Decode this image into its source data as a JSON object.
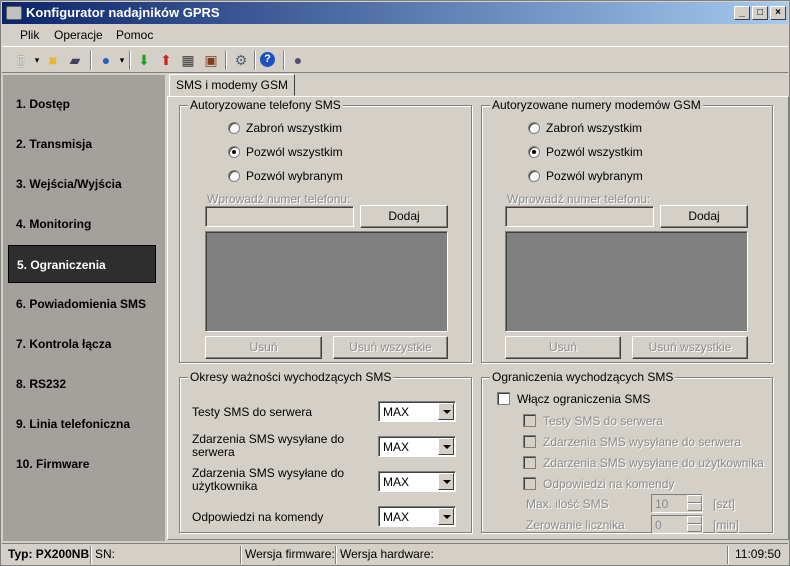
{
  "window": {
    "title": "Konfigurator nadajników GPRS",
    "minimize": "_",
    "maximize": "□",
    "close": "×"
  },
  "menu": [
    "Plik",
    "Operacje",
    "Pomoc"
  ],
  "toolbar": {
    "icons": [
      "new-icon",
      "open-folder-icon",
      "save-icon",
      "connect-globe-icon",
      "download-icon",
      "upload-icon",
      "calendar-icon",
      "computer-icon",
      "settings-icon",
      "help-icon",
      "exit-icon"
    ]
  },
  "sidebar": {
    "items": [
      {
        "label": "1. Dostęp"
      },
      {
        "label": "2. Transmisja"
      },
      {
        "label": "3. Wejścia/Wyjścia"
      },
      {
        "label": "4. Monitoring"
      },
      {
        "label": "5. Ograniczenia",
        "active": true
      },
      {
        "label": "6. Powiadomienia SMS"
      },
      {
        "label": "7. Kontrola łącza"
      },
      {
        "label": "8. RS232"
      },
      {
        "label": "9. Linia telefoniczna"
      },
      {
        "label": "10. Firmware"
      }
    ]
  },
  "tab": {
    "label": "SMS i modemy GSM"
  },
  "phones": {
    "title": "Autoryzowane telefony SMS",
    "radios": [
      "Zabroń wszystkim",
      "Pozwól wszystkim",
      "Pozwól wybranym"
    ],
    "selected": 1,
    "input_label": "Wprowadź numer telefonu:",
    "input_value": "",
    "add": "Dodaj",
    "remove": "Usuń",
    "remove_all": "Usuń wszystkie"
  },
  "modems": {
    "title": "Autoryzowane numery modemów GSM",
    "radios": [
      "Zabroń wszystkim",
      "Pozwól wszystkim",
      "Pozwól wybranym"
    ],
    "selected": 1,
    "input_label": "Wprowadź numer telefonu:",
    "input_value": "",
    "add": "Dodaj",
    "remove": "Usuń",
    "remove_all": "Usuń wszystkie"
  },
  "validity": {
    "title": "Okresy ważności wychodzących SMS",
    "rows": [
      {
        "label": "Testy SMS do serwera",
        "value": "MAX"
      },
      {
        "label": "Zdarzenia SMS wysyłane do\nserwera",
        "value": "MAX"
      },
      {
        "label": "Zdarzenia SMS wysyłane do\nużytkownika",
        "value": "MAX"
      },
      {
        "label": "Odpowiedzi na komendy",
        "value": "MAX"
      }
    ]
  },
  "limits": {
    "title": "Ograniczenia wychodzących SMS",
    "enable": "Włącz ograniczenia SMS",
    "items": [
      "Testy SMS do serwera",
      "Zdarzenia SMS wysyłane do serwera",
      "Zdarzenia SMS wysyłane do użytkownika",
      "Odpowiedzi na komendy"
    ],
    "max_label": "Max. ilość SMS",
    "max_value": "10",
    "max_unit": "[szt]",
    "reset_label": "Zerowanie licznika",
    "reset_value": "0",
    "reset_unit": "[min]"
  },
  "status": {
    "type": "Typ: PX200NB",
    "sn": "SN:",
    "firmware": "Wersja firmware:",
    "hardware": "Wersja hardware:",
    "time": "11:09:50"
  }
}
